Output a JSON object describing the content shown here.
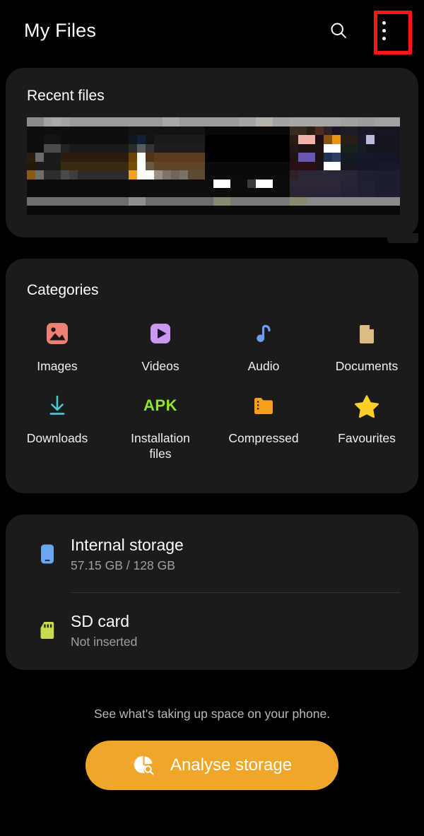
{
  "appbar": {
    "title": "My Files",
    "search_icon": "search-icon",
    "more_icon": "more-vertical-icon"
  },
  "recent": {
    "title": "Recent files"
  },
  "categories": {
    "title": "Categories",
    "items": [
      {
        "label": "Images",
        "icon": "image-icon",
        "color": "#ed8073"
      },
      {
        "label": "Videos",
        "icon": "video-play-icon",
        "color": "#cb97f2"
      },
      {
        "label": "Audio",
        "icon": "music-note-icon",
        "color": "#6f9ef0"
      },
      {
        "label": "Documents",
        "icon": "document-icon",
        "color": "#ddbb84"
      },
      {
        "label": "Downloads",
        "icon": "download-icon",
        "color": "#52c5cc"
      },
      {
        "label": "Installation\nfiles",
        "icon": "apk-icon",
        "color": "#8ee62c"
      },
      {
        "label": "Compressed",
        "icon": "zip-folder-icon",
        "color": "#f79f1b"
      },
      {
        "label": "Favourites",
        "icon": "star-icon",
        "color": "#fbd024"
      }
    ],
    "apk_text": "APK",
    "installation_line1": "Installation",
    "installation_line2": "files"
  },
  "storage": {
    "rows": [
      {
        "name": "Internal storage",
        "sub": "57.15 GB / 128 GB",
        "icon": "phone-icon",
        "color": "#6ba6f0"
      },
      {
        "name": "SD card",
        "sub": "Not inserted",
        "icon": "sdcard-icon",
        "color": "#cada4e"
      }
    ]
  },
  "bottom": {
    "hint": "See what's taking up space on your phone.",
    "analyse_label": "Analyse storage",
    "analyse_icon": "pie-chart-search-icon",
    "button_color": "#f0a629"
  },
  "annotation": {
    "highlight_color": "#ff1515",
    "highlight_target": "more-vertical-icon"
  },
  "thumbstrip": {
    "rows": [
      [
        "#8a8a8a",
        "#8a8a8a",
        "#a3a3a3",
        "#a9a9a9",
        "#a3a3a3",
        "#9b9b9b",
        "#9b9b9b",
        "#9b9b9b",
        "#9b9b9b",
        "#9b9b9b",
        "#9b9b9b",
        "#9b9b9b",
        "#9b9b9b",
        "#9b9b9b",
        "#9b9b9b",
        "#9b9b9b",
        "#a8a8a8",
        "#a8a8a8",
        "#9c9c9c",
        "#9c9c9c",
        "#9c9c9c",
        "#9c9c9c",
        "#9c9c9c",
        "#9c9c9c",
        "#9c9c9c",
        "#a5a5a5",
        "#a5a5a5",
        "#b6b2ab",
        "#b6b2ab",
        "#a5a3a0",
        "#a5a3a0",
        "#a9a7a4",
        "#a9a7a4",
        "#a9a7a4",
        "#a9a7a4",
        "#a6a6a8",
        "#a6a6a8",
        "#a29fa0",
        "#a29fa0",
        "#9d9b9d",
        "#9d9b9d",
        "#a3a1a4",
        "#a3a1a4",
        "#a3a1a4"
      ],
      [
        "#0e0e0e",
        "#0e0e0e",
        "#0e0e0e",
        "#0e0e0e",
        "#0e0e0e",
        "#0e0e0e",
        "#0e0e0e",
        "#0e0e0e",
        "#0e0e0e",
        "#0e0e0e",
        "#0e0e0e",
        "#0e0e0e",
        "#131313",
        "#131313",
        "#131313",
        "#131313",
        "#131313",
        "#131313",
        "#131313",
        "#131313",
        "#131313",
        "#080808",
        "#080808",
        "#080808",
        "#080808",
        "#080808",
        "#080808",
        "#080808",
        "#080808",
        "#080808",
        "#080808",
        "#3a2a1e",
        "#3a2a1e",
        "#2a1b14",
        "#4a2d1c",
        "#2e2228",
        "#1b1622",
        "#1e1a26",
        "#1e1a26",
        "#1b1726",
        "#1b1726",
        "#171524",
        "#171524",
        "#171524"
      ],
      [
        "#0e0e0e",
        "#0e0e0e",
        "#141414",
        "#141414",
        "#0e0e0e",
        "#0e0e0e",
        "#0e0e0e",
        "#0e0e0e",
        "#0e0e0e",
        "#0e0e0e",
        "#0e0e0e",
        "#0e0e0e",
        "#10161f",
        "#122033",
        "#121313",
        "#1a1a1a",
        "#1a1a1a",
        "#1a1a1a",
        "#1a1a1a",
        "#1a1a1a",
        "#1a1a1a",
        "#000000",
        "#000000",
        "#000000",
        "#000000",
        "#000000",
        "#000000",
        "#000000",
        "#000000",
        "#000000",
        "#000000",
        "#2a1d17",
        "#efb3a9",
        "#efb3a9",
        "#1c1012",
        "#8a5410",
        "#e8960d",
        "#291d18",
        "#291d18",
        "#1a1a28",
        "#b9bbd8",
        "#16141f",
        "#16141f",
        "#16141f"
      ],
      [
        "#0e0e0e",
        "#0e0e0e",
        "#4a4a4a",
        "#4a4a4a",
        "#222222",
        "#1a1a1a",
        "#1a1a1a",
        "#1a1a1a",
        "#1a1a1a",
        "#1a1a1a",
        "#1a1a1a",
        "#1a1a1a",
        "#2b2b2b",
        "#5b5b5b",
        "#333333",
        "#1d1d1d",
        "#1d1d1d",
        "#1d1d1d",
        "#1d1d1d",
        "#1d1d1d",
        "#1d1d1d",
        "#000000",
        "#000000",
        "#000000",
        "#000000",
        "#000000",
        "#000000",
        "#000000",
        "#000000",
        "#000000",
        "#000000",
        "#251714",
        "#1d1412",
        "#1d1412",
        "#1d1412",
        "#ffffff",
        "#ffffff",
        "#16231a",
        "#16231a",
        "#171b26",
        "#13151f",
        "#13151f",
        "#13151f",
        "#13151f"
      ],
      [
        "#2a1d0c",
        "#6b6b6b",
        "#1b1b1b",
        "#1b1b1b",
        "#2a1d0d",
        "#2a1d0d",
        "#2a1d0d",
        "#2a1d0d",
        "#2a1d0d",
        "#2a1d0d",
        "#2a1d0d",
        "#2a1d0d",
        "#6d4400",
        "#ffffff",
        "#4e3418",
        "#5b3c1c",
        "#5b3c1c",
        "#5b3c1c",
        "#5b3c1c",
        "#5b3c1c",
        "#5b3c1c",
        "#000000",
        "#000000",
        "#000000",
        "#000000",
        "#000000",
        "#000000",
        "#000000",
        "#000000",
        "#000000",
        "#000000",
        "#1e1416",
        "#6a55b0",
        "#6a55b0",
        "#1a1210",
        "#223050",
        "#2a3f66",
        "#121a22",
        "#121a22",
        "#16182a",
        "#16182a",
        "#141626",
        "#141626",
        "#141626"
      ],
      [
        "#241a09",
        "#1b1b1b",
        "#1b1b1b",
        "#1b1b1b",
        "#3a2a12",
        "#3a2a12",
        "#3a2a12",
        "#3a2a12",
        "#3a2a12",
        "#3a2a12",
        "#3a2a12",
        "#3a2a12",
        "#7a4c05",
        "#ffffff",
        "#6b5a42",
        "#5e4526",
        "#5e4526",
        "#5e4526",
        "#5e4526",
        "#5e4526",
        "#5e4526",
        "#0a0a0a",
        "#0a0a0a",
        "#0a0a0a",
        "#0a0a0a",
        "#0a0a0a",
        "#0a0a0a",
        "#0a0a0a",
        "#0a0a0a",
        "#0a0a0a",
        "#0a0a0a",
        "#2a1012",
        "#2a1012",
        "#2a1012",
        "#1d1214",
        "#ffffff",
        "#ffffff",
        "#17171f",
        "#17171f",
        "#14162a",
        "#14162a",
        "#15172a",
        "#15172a",
        "#15172a"
      ],
      [
        "#8a5a13",
        "#6f6f6f",
        "#2e2e2e",
        "#2e2e2e",
        "#4a4a4a",
        "#3e3e3e",
        "#2c2c2c",
        "#2c2c2c",
        "#2c2c2c",
        "#2c2c2c",
        "#2c2c2c",
        "#2c2c2c",
        "#f0a024",
        "#ffffff",
        "#ffffff",
        "#9a9186",
        "#7c746b",
        "#6e665e",
        "#7b7168",
        "#5c4a35",
        "#5c4a35",
        "#0a0a0a",
        "#0a0a0a",
        "#0a0a0a",
        "#0a0a0a",
        "#0a0a0a",
        "#0a0a0a",
        "#0a0a0a",
        "#0a0a0a",
        "#0a0a0a",
        "#0a0a0a",
        "#30202a",
        "#2a2736",
        "#2a2736",
        "#2a2736",
        "#2a2736",
        "#2a2736",
        "#262636",
        "#262636",
        "#1d1f32",
        "#1d1f32",
        "#1c1e30",
        "#1c1e30",
        "#1c1e30"
      ],
      [
        "#0b0b0b",
        "#0b0b0b",
        "#0b0b0b",
        "#0b0b0b",
        "#0b0b0b",
        "#0b0b0b",
        "#0b0b0b",
        "#0b0b0b",
        "#0b0b0b",
        "#0b0b0b",
        "#0b0b0b",
        "#0b0b0b",
        "#0d0d0d",
        "#0d0d0d",
        "#0d0d0d",
        "#0d0d0d",
        "#0d0d0d",
        "#0d0d0d",
        "#0d0d0d",
        "#0d0d0d",
        "#0d0d0d",
        "#0d0d0d",
        "#ffffff",
        "#ffffff",
        "#0b0b0b",
        "#0b0b0b",
        "#3b3b3b",
        "#ffffff",
        "#ffffff",
        "#0b0b0b",
        "#0b0b0b",
        "#2c2636",
        "#2c2636",
        "#2c2636",
        "#2c2636",
        "#2c2636",
        "#2c2636",
        "#252536",
        "#252536",
        "#1e2034",
        "#1e2034",
        "#1c1e30",
        "#1c1e30",
        "#1c1e30"
      ],
      [
        "#0b0b0b",
        "#0b0b0b",
        "#0b0b0b",
        "#0b0b0b",
        "#0b0b0b",
        "#0b0b0b",
        "#0b0b0b",
        "#0b0b0b",
        "#0b0b0b",
        "#0b0b0b",
        "#0b0b0b",
        "#0b0b0b",
        "#0d0d0d",
        "#0d0d0d",
        "#0d0d0d",
        "#0d0d0d",
        "#0d0d0d",
        "#0d0d0d",
        "#0d0d0d",
        "#0d0d0d",
        "#0d0d0d",
        "#0d0d0d",
        "#0d0d0d",
        "#0d0d0d",
        "#0b0b0b",
        "#0b0b0b",
        "#0b0b0b",
        "#0b0b0b",
        "#0b0b0b",
        "#0b0b0b",
        "#0b0b0b",
        "#2a2434",
        "#2a2434",
        "#2a2434",
        "#2a2434",
        "#2a2434",
        "#2a2434",
        "#232334",
        "#232334",
        "#1e2034",
        "#1e2034",
        "#1c1e30",
        "#1c1e30",
        "#1c1e30"
      ],
      [
        "#6e6e6e",
        "#6e6e6e",
        "#6e6e6e",
        "#6e6e6e",
        "#6e6e6e",
        "#6e6e6e",
        "#6e6e6e",
        "#6e6e6e",
        "#6e6e6e",
        "#6e6e6e",
        "#6e6e6e",
        "#6e6e6e",
        "#8f8f8f",
        "#8f8f8f",
        "#6e6e6e",
        "#6e6e6e",
        "#6e6e6e",
        "#6e6e6e",
        "#6e6e6e",
        "#6e6e6e",
        "#6e6e6e",
        "#6e6e6e",
        "#8a8a70",
        "#8a8a70",
        "#7a7a76",
        "#7a7a76",
        "#7a7a76",
        "#7a7a76",
        "#7a7a76",
        "#7a7a76",
        "#7a7a76",
        "#8a8a6e",
        "#8a8a6e",
        "#8a8a8a",
        "#8a8a8a",
        "#8a8a8a",
        "#8a8a8a",
        "#8a8a8a",
        "#8a8a8a",
        "#8a8a8a",
        "#8a8a8a",
        "#8a8a8a",
        "#8a8a8a",
        "#8a8a8a"
      ],
      [
        "#0a0a0a",
        "#0a0a0a",
        "#0a0a0a",
        "#0a0a0a",
        "#0a0a0a",
        "#0a0a0a",
        "#0a0a0a",
        "#0a0a0a",
        "#0a0a0a",
        "#0a0a0a",
        "#0a0a0a",
        "#0a0a0a",
        "#0a0a0a",
        "#0a0a0a",
        "#0a0a0a",
        "#0a0a0a",
        "#0a0a0a",
        "#0a0a0a",
        "#0a0a0a",
        "#0a0a0a",
        "#0a0a0a",
        "#0a0a0a",
        "#0a0a0a",
        "#0a0a0a",
        "#0a0a0a",
        "#0a0a0a",
        "#0a0a0a",
        "#0a0a0a",
        "#0a0a0a",
        "#0a0a0a",
        "#0a0a0a",
        "#0a0a0a",
        "#0a0a0a",
        "#0a0a0a",
        "#0a0a0a",
        "#0a0a0a",
        "#0a0a0a",
        "#0a0a0a",
        "#0a0a0a",
        "#0a0a0a",
        "#0a0a0a",
        "#0a0a0a",
        "#0a0a0a",
        "#0a0a0a"
      ]
    ]
  }
}
